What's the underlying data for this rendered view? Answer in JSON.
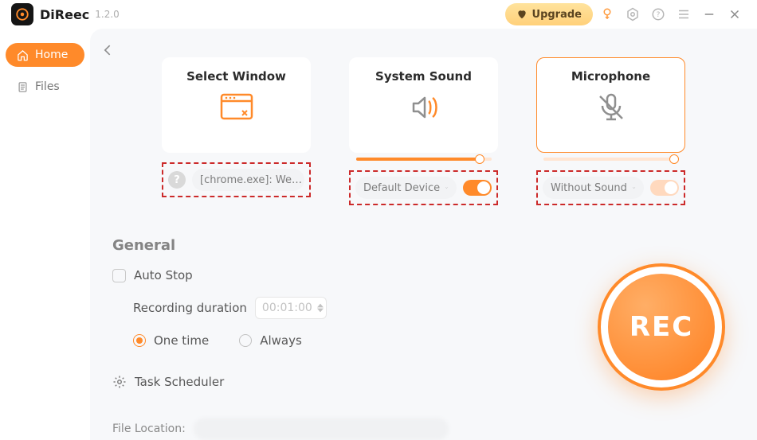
{
  "titlebar": {
    "brand": "DiReec",
    "version": "1.2.0",
    "upgrade": "Upgrade"
  },
  "sidebar": {
    "items": [
      {
        "label": "Home"
      },
      {
        "label": "Files"
      }
    ]
  },
  "cards": {
    "window": {
      "title": "Select Window",
      "value": "[chrome.exe]: We…"
    },
    "system": {
      "title": "System Sound",
      "value": "Default Device"
    },
    "mic": {
      "title": "Microphone",
      "value": "Without Sound"
    }
  },
  "general": {
    "heading": "General",
    "auto_stop": "Auto Stop",
    "duration_label": "Recording duration",
    "duration_value": "00:01:00",
    "one_time": "One time",
    "always": "Always",
    "task": "Task Scheduler",
    "file_label": "File Location:"
  },
  "rec": "REC"
}
